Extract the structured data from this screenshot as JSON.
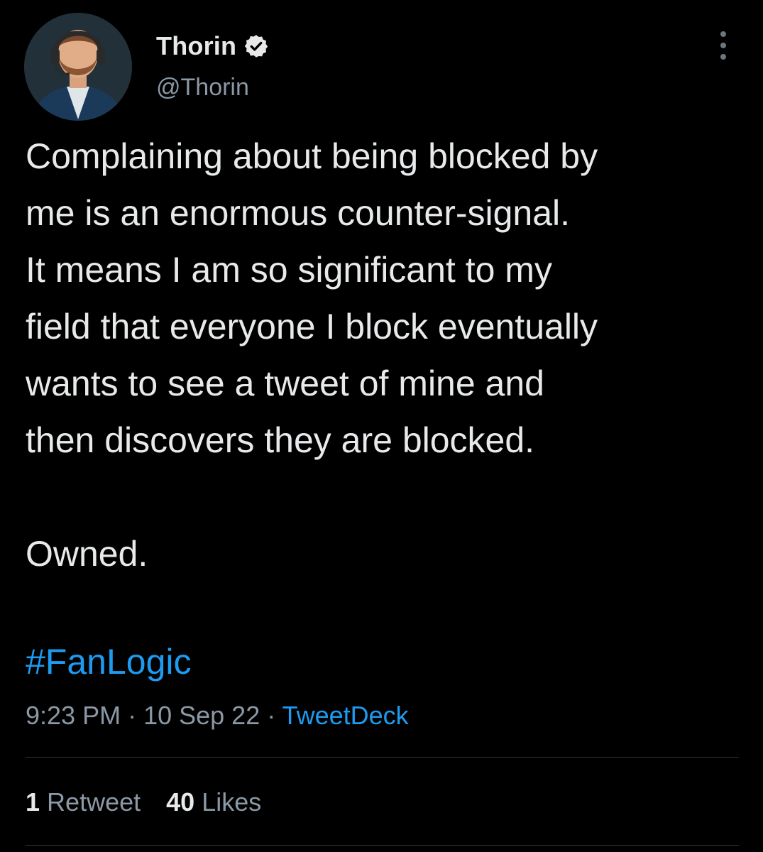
{
  "author": {
    "display_name": "Thorin",
    "handle": "@Thorin",
    "verified": true,
    "avatar_icon": "avatar-portrait-headset"
  },
  "menu_icon": "more-vertical-icon",
  "tweet": {
    "text": "Complaining about being blocked by\nme is an enormous counter-signal.\nIt means I am so significant to my\nfield that everyone I block eventually\nwants to see a tweet of mine and\nthen discovers they are blocked.\n\nOwned.",
    "hashtag": "#FanLogic"
  },
  "meta": {
    "time": "9:23 PM",
    "separator": " · ",
    "date": "10 Sep 22",
    "source": "TweetDeck"
  },
  "stats": {
    "retweets_count": "1",
    "retweets_label": "Retweet",
    "likes_count": "40",
    "likes_label": "Likes"
  },
  "colors": {
    "background": "#000000",
    "text": "#e7e9ea",
    "secondary": "#8b98a5",
    "accent": "#1d9bf0",
    "divider": "#2f3336"
  }
}
